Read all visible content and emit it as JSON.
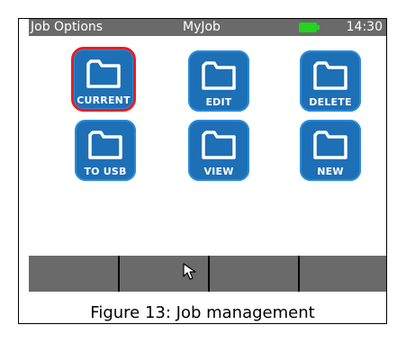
{
  "statusbar": {
    "left_label": "Job Options",
    "title": "MyJob",
    "time": "14:30",
    "battery_color": "#22d41d"
  },
  "job_buttons": [
    {
      "label": "CURRENT",
      "icon": "folder-icon",
      "selected": true
    },
    {
      "label": "EDIT",
      "icon": "folder-icon",
      "selected": false
    },
    {
      "label": "DELETE",
      "icon": "folder-icon",
      "selected": false
    },
    {
      "label": "TO USB",
      "icon": "folder-icon",
      "selected": false
    },
    {
      "label": "VIEW",
      "icon": "folder-icon",
      "selected": false
    },
    {
      "label": "NEW",
      "icon": "folder-icon",
      "selected": false
    }
  ],
  "softkeys": [
    "",
    "",
    "",
    ""
  ],
  "colors": {
    "accent": "#1d6fb6",
    "selected_outline": "#e61e24",
    "bar": "#6a6a6a"
  },
  "caption": "Figure 13: Job management"
}
